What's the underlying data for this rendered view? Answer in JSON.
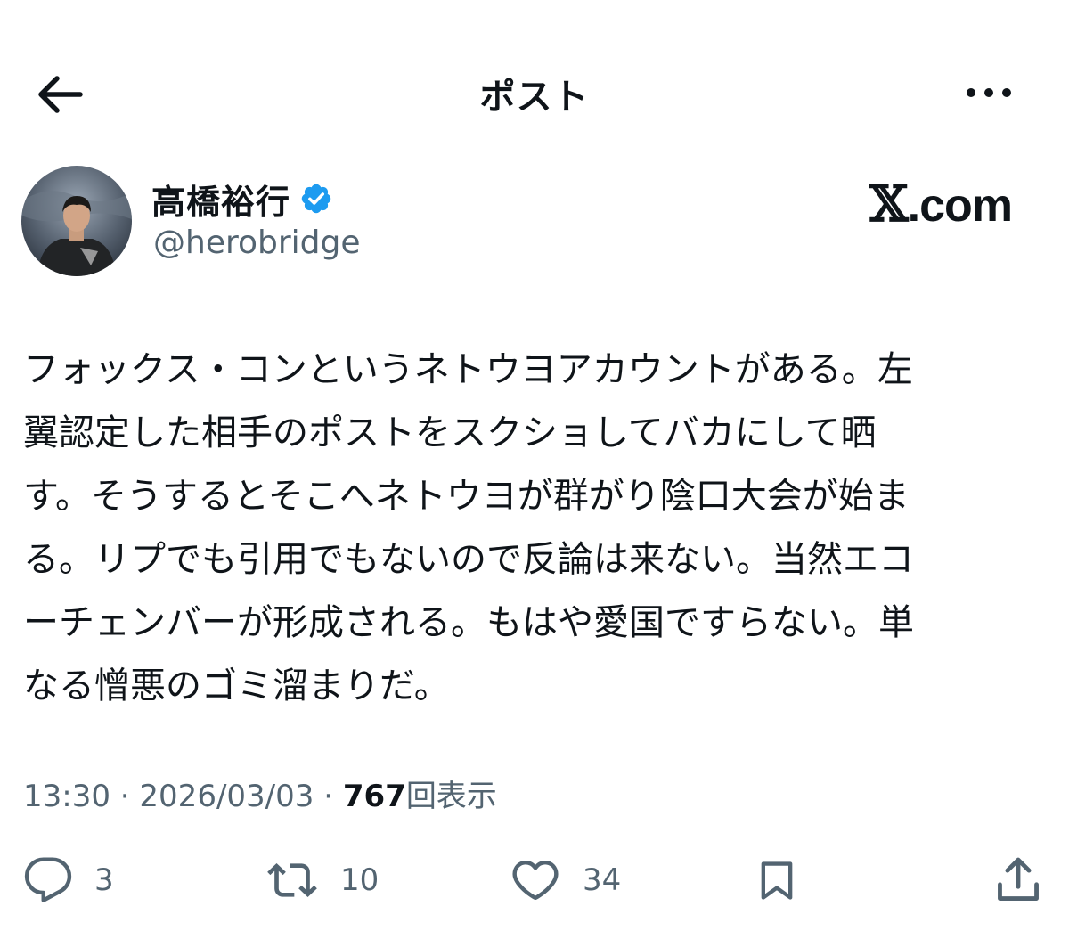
{
  "header": {
    "title": "ポスト",
    "back_icon": "arrow-left-icon",
    "more_icon": "more-horizontal-icon"
  },
  "author": {
    "name": "高橋裕行",
    "handle": "@herobridge",
    "verified": true,
    "verified_color": "#1d9bf0"
  },
  "brand": {
    "x_char": "𝕏",
    "suffix": ".com"
  },
  "post": {
    "lines": [
      "フォックス・コンというネトウヨアカウントがある。左",
      "翼認定した相手のポストをスクショしてバカにして晒",
      "す。そうするとそこへネトウヨが群がり陰口大会が始ま",
      "る。リプでも引用でもないので反論は来ない。当然エコ",
      "ーチェンバーが形成される。もはや愛国ですらない。単",
      "なる憎悪のゴミ溜まりだ。"
    ]
  },
  "meta": {
    "time": "13:30",
    "separator": "·",
    "date": "2026/03/03",
    "views_count": "767",
    "views_label": "回表示"
  },
  "actions": {
    "reply_count": "3",
    "repost_count": "10",
    "like_count": "34"
  },
  "colors": {
    "text": "#0f1419",
    "secondary": "#536471",
    "accent": "#1d9bf0"
  }
}
